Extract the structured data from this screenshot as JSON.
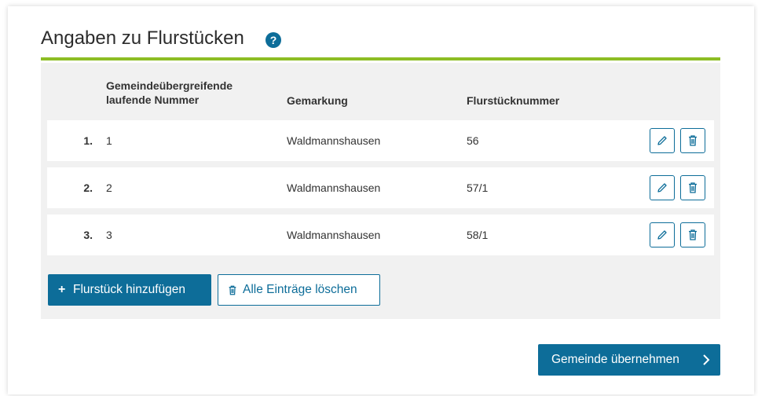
{
  "section": {
    "title": "Angaben zu Flurstücken",
    "help_icon": "question-circle-icon",
    "help_glyph": "?"
  },
  "table": {
    "headers": {
      "number_line1": "Gemeindeübergreifende",
      "number_line2": "laufende Nummer",
      "gemarkung": "Gemarkung",
      "flurstueck": "Flurstücknummer"
    },
    "rows": [
      {
        "index": "1.",
        "number": "1",
        "gemarkung": "Waldmannshausen",
        "flurstueck": "56"
      },
      {
        "index": "2.",
        "number": "2",
        "gemarkung": "Waldmannshausen",
        "flurstueck": "57/1"
      },
      {
        "index": "3.",
        "number": "3",
        "gemarkung": "Waldmannshausen",
        "flurstueck": "58/1"
      }
    ],
    "row_actions": {
      "edit_icon": "pencil-icon",
      "delete_icon": "trash-icon"
    }
  },
  "actions": {
    "add_label": "Flurstück hinzufügen",
    "add_glyph": "+",
    "clear_all_label": "Alle Einträge löschen",
    "submit_label": "Gemeinde übernehmen"
  },
  "colors": {
    "accent": "#0d6d99",
    "underline": "#8dbd24",
    "panel_bg": "#f1f1f1"
  }
}
